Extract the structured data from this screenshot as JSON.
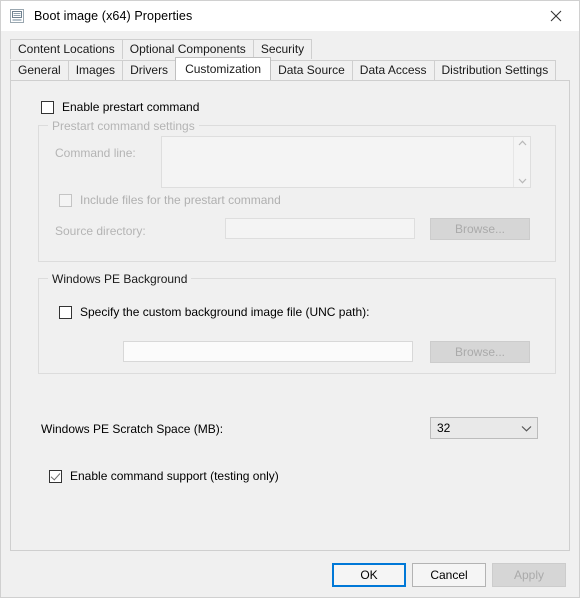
{
  "window": {
    "title": "Boot image (x64) Properties",
    "icon": "boot-image-icon",
    "close_glyph": "✕"
  },
  "tabs": {
    "row1": [
      {
        "label": "Content Locations",
        "active": false
      },
      {
        "label": "Optional Components",
        "active": false
      },
      {
        "label": "Security",
        "active": false
      }
    ],
    "row2": [
      {
        "label": "General",
        "active": false
      },
      {
        "label": "Images",
        "active": false
      },
      {
        "label": "Drivers",
        "active": false
      },
      {
        "label": "Customization",
        "active": true
      },
      {
        "label": "Data Source",
        "active": false
      },
      {
        "label": "Data Access",
        "active": false
      },
      {
        "label": "Distribution Settings",
        "active": false
      }
    ]
  },
  "prestart": {
    "enable_label": "Enable prestart command",
    "enable_checked": false,
    "group_title": "Prestart command settings",
    "command_line_label": "Command line:",
    "command_line_value": "",
    "include_files_label": "Include files for the prestart command",
    "include_files_checked": false,
    "source_directory_label": "Source directory:",
    "source_directory_value": "",
    "browse_label": "Browse..."
  },
  "background": {
    "group_title": "Windows PE Background",
    "specify_label": "Specify the custom background image file (UNC path):",
    "specify_checked": false,
    "path_value": "",
    "browse_label": "Browse..."
  },
  "scratch": {
    "label": "Windows PE Scratch Space (MB):",
    "value": "32"
  },
  "command_support": {
    "label": "Enable command support (testing only)",
    "checked": true
  },
  "footer": {
    "ok_label": "OK",
    "cancel_label": "Cancel",
    "apply_label": "Apply"
  },
  "colors": {
    "accent": "#0078d7",
    "dialog_bg": "#f0f0f0",
    "panel_bg": "#f0f0f0",
    "disabled_text": "#b4b4b4"
  }
}
